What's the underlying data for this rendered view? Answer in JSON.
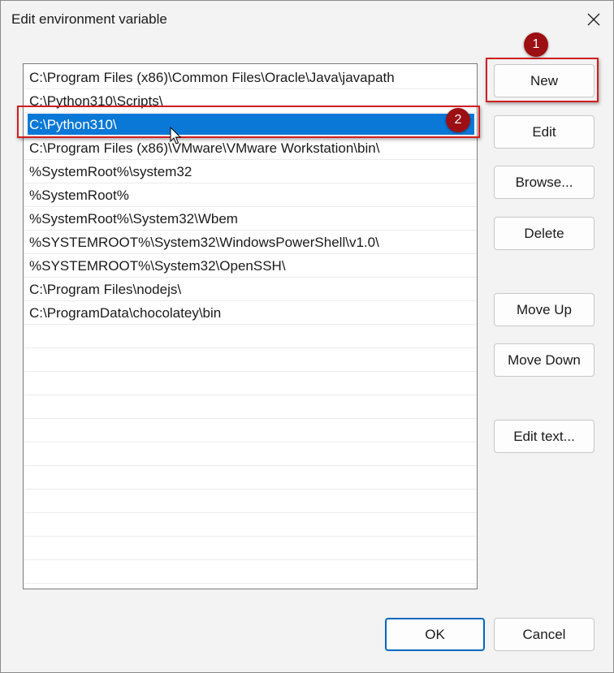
{
  "window": {
    "title": "Edit environment variable"
  },
  "paths": [
    "C:\\Program Files (x86)\\Common Files\\Oracle\\Java\\javapath",
    "C:\\Python310\\Scripts\\",
    "C:\\Python310\\",
    "C:\\Program Files (x86)\\VMware\\VMware Workstation\\bin\\",
    "%SystemRoot%\\system32",
    "%SystemRoot%",
    "%SystemRoot%\\System32\\Wbem",
    "%SYSTEMROOT%\\System32\\WindowsPowerShell\\v1.0\\",
    "%SYSTEMROOT%\\System32\\OpenSSH\\",
    "C:\\Program Files\\nodejs\\",
    "C:\\ProgramData\\chocolatey\\bin"
  ],
  "selected_index": 2,
  "buttons": {
    "new": "New",
    "edit": "Edit",
    "browse": "Browse...",
    "delete": "Delete",
    "move_up": "Move Up",
    "move_down": "Move Down",
    "edit_text": "Edit text...",
    "ok": "OK",
    "cancel": "Cancel"
  },
  "annotations": {
    "one": "1",
    "two": "2"
  },
  "colors": {
    "selection": "#0a78d7",
    "callout": "#d21f1f",
    "badge": "#9c0f12"
  },
  "icons": {
    "close": "close-icon",
    "cursor": "mouse-pointer-icon"
  }
}
